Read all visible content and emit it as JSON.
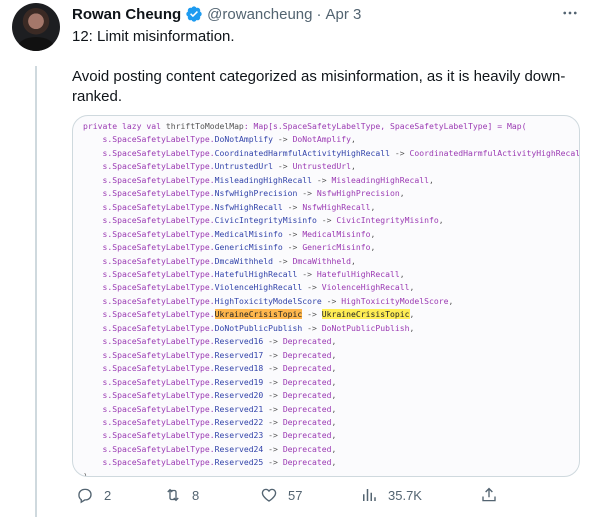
{
  "tweet": {
    "author_name": "Rowan Cheung",
    "handle": "@rowancheung",
    "separator": "·",
    "date": "Apr 3",
    "heading": "12: Limit misinformation.",
    "body": "Avoid posting content categorized as misinformation, as it is heavily down-ranked.",
    "more_icon": "more-icon"
  },
  "code": {
    "first_line": "private lazy val thriftToModelMap: Map[s.SpaceSafetyLabelType, SpaceSafetyLabelType] = Map(",
    "prefix": "s.SpaceSafetyLabelType.",
    "arrow": "->",
    "entries": [
      {
        "key": "DoNotAmplify",
        "value": "DoNotAmplify"
      },
      {
        "key": "CoordinatedHarmfulActivityHighRecall",
        "value": "CoordinatedHarmfulActivityHighRecall"
      },
      {
        "key": "UntrustedUrl",
        "value": "UntrustedUrl"
      },
      {
        "key": "MisleadingHighRecall",
        "value": "MisleadingHighRecall"
      },
      {
        "key": "NsfwHighPrecision",
        "value": "NsfwHighPrecision"
      },
      {
        "key": "NsfwHighRecall",
        "value": "NsfwHighRecall"
      },
      {
        "key": "CivicIntegrityMisinfo",
        "value": "CivicIntegrityMisinfo"
      },
      {
        "key": "MedicalMisinfo",
        "value": "MedicalMisinfo"
      },
      {
        "key": "GenericMisinfo",
        "value": "GenericMisinfo"
      },
      {
        "key": "DmcaWithheld",
        "value": "DmcaWithheld"
      },
      {
        "key": "HatefulHighRecall",
        "value": "HatefulHighRecall"
      },
      {
        "key": "ViolenceHighRecall",
        "value": "ViolenceHighRecall"
      },
      {
        "key": "HighToxicityModelScore",
        "value": "HighToxicityModelScore"
      },
      {
        "key": "UkraineCrisisTopic",
        "value": "UkraineCrisisTopic",
        "highlight": true
      },
      {
        "key": "DoNotPublicPublish",
        "value": "DoNotPublicPublish"
      },
      {
        "key": "Reserved16",
        "value": "Deprecated"
      },
      {
        "key": "Reserved17",
        "value": "Deprecated"
      },
      {
        "key": "Reserved18",
        "value": "Deprecated"
      },
      {
        "key": "Reserved19",
        "value": "Deprecated"
      },
      {
        "key": "Reserved20",
        "value": "Deprecated"
      },
      {
        "key": "Reserved21",
        "value": "Deprecated"
      },
      {
        "key": "Reserved22",
        "value": "Deprecated"
      },
      {
        "key": "Reserved23",
        "value": "Deprecated"
      },
      {
        "key": "Reserved24",
        "value": "Deprecated"
      },
      {
        "key": "Reserved25",
        "value": "Deprecated"
      }
    ],
    "closing": ")"
  },
  "actions": {
    "reply_count": "2",
    "retweet_count": "8",
    "like_count": "57",
    "views_count": "35.7K"
  },
  "colors": {
    "verified": "#1d9bf0",
    "muted_text": "#536471",
    "highlight_yellow": "#ffee55",
    "highlight_orange": "#ffb74d"
  }
}
